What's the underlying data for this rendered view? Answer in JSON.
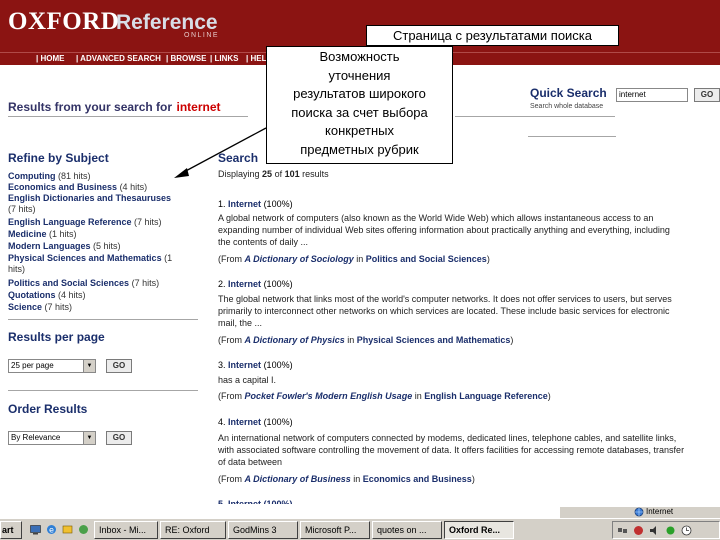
{
  "header": {
    "logo_main": "OXFORD",
    "logo_ref": "Reference",
    "logo_sub": "ONLINE",
    "nav": [
      "| HOME",
      "| ADVANCED SEARCH",
      "| BROWSE",
      "| LINKS",
      "| HEL"
    ]
  },
  "overlay": {
    "title": "Страница с результатами поиска",
    "note_lines": [
      "Возможность",
      "уточнения",
      "результатов широкого",
      "поиска за счет выбора",
      "конкретных",
      "предметных рубрик"
    ]
  },
  "page": {
    "results_prefix": "Results from your search for",
    "query": "internet",
    "search_heading_partial": "Search"
  },
  "quick_search": {
    "label": "Quick Search",
    "sub": "Search whole database",
    "value": "internet",
    "go": "GO"
  },
  "refine": {
    "heading": "Refine by Subject",
    "subjects": [
      {
        "name": "Computing",
        "hits": "(81 hits)"
      },
      {
        "name": "Economics and Business",
        "hits": "(4 hits)"
      },
      {
        "name": "English Dictionaries and Thesauruses",
        "hits": ""
      },
      {
        "name": "",
        "hits": "(7 hits)"
      },
      {
        "name": "English Language Reference",
        "hits": "(7 hits)"
      },
      {
        "name": "Medicine",
        "hits": "(1 hits)"
      },
      {
        "name": "Modern Languages",
        "hits": "(5 hits)"
      },
      {
        "name": "Physical Sciences and Mathematics",
        "hits": "(1"
      },
      {
        "name": "",
        "hits": "hits)"
      },
      {
        "name": "Politics and Social Sciences",
        "hits": "(7 hits)"
      },
      {
        "name": "Quotations",
        "hits": "(4 hits)"
      },
      {
        "name": "Science",
        "hits": "(7 hits)"
      }
    ]
  },
  "per_page": {
    "heading": "Results per page",
    "selected": "25 per page",
    "go": "GO"
  },
  "order": {
    "heading": "Order Results",
    "selected": "By Relevance",
    "go": "GO"
  },
  "results": {
    "displaying": "Displaying",
    "count_shown": "25",
    "of_word": "of",
    "total": "101",
    "results_word": "results",
    "items": [
      {
        "num": "1.",
        "term": "Internet",
        "score": "(100%)",
        "lines": [
          "A global network of computers (also known as the World Wide Web) which allows instantaneous access to an",
          "expanding number of individual Web sites offering information about practically anything and everything, including",
          "the contents of daily ..."
        ],
        "from_pre": "(From",
        "book": "A Dictionary of Sociology",
        "in_word": "in",
        "subject": "Politics and Social Sciences",
        "close": ")"
      },
      {
        "num": "2.",
        "term": "Internet",
        "score": "(100%)",
        "lines": [
          "The global network that links most of the world's computer networks. It does not offer services to users, but serves",
          "primarily to interconnect other networks on which services are located. These include basic services for electronic",
          "mail, the ..."
        ],
        "from_pre": "(From",
        "book": "A Dictionary of Physics",
        "in_word": "in",
        "subject": "Physical Sciences and Mathematics",
        "close": ")"
      },
      {
        "num": "3.",
        "term": "Internet",
        "score": "(100%)",
        "lines": [
          "has a capital I."
        ],
        "from_pre": "(From",
        "book": "Pocket Fowler's Modern English Usage",
        "in_word": "in",
        "subject": "English Language Reference",
        "close": ")"
      },
      {
        "num": "4.",
        "term": "Internet",
        "score": "(100%)",
        "lines": [
          "An international network of computers connected by modems, dedicated lines, telephone cables, and satellite links,",
          "with associated software controlling the movement of data. It offers facilities for accessing remote databases, transfer",
          "of data between"
        ],
        "from_pre": "(From",
        "book": "A Dictionary of Business",
        "in_word": "in",
        "subject": "Economics and Business",
        "close": ")"
      }
    ]
  },
  "status": {
    "text": "Internet"
  },
  "taskbar": {
    "start": "art",
    "items": [
      "Inbox - Mi...",
      "RE: Oxford",
      "GodMins 3",
      "Microsoft P...",
      "quotes on ...",
      "Oxford Re..."
    ],
    "active_index": 5
  },
  "colors": {
    "brand": "#8b1412",
    "link": "#1a2e6b",
    "keyword": "#cc0000"
  }
}
